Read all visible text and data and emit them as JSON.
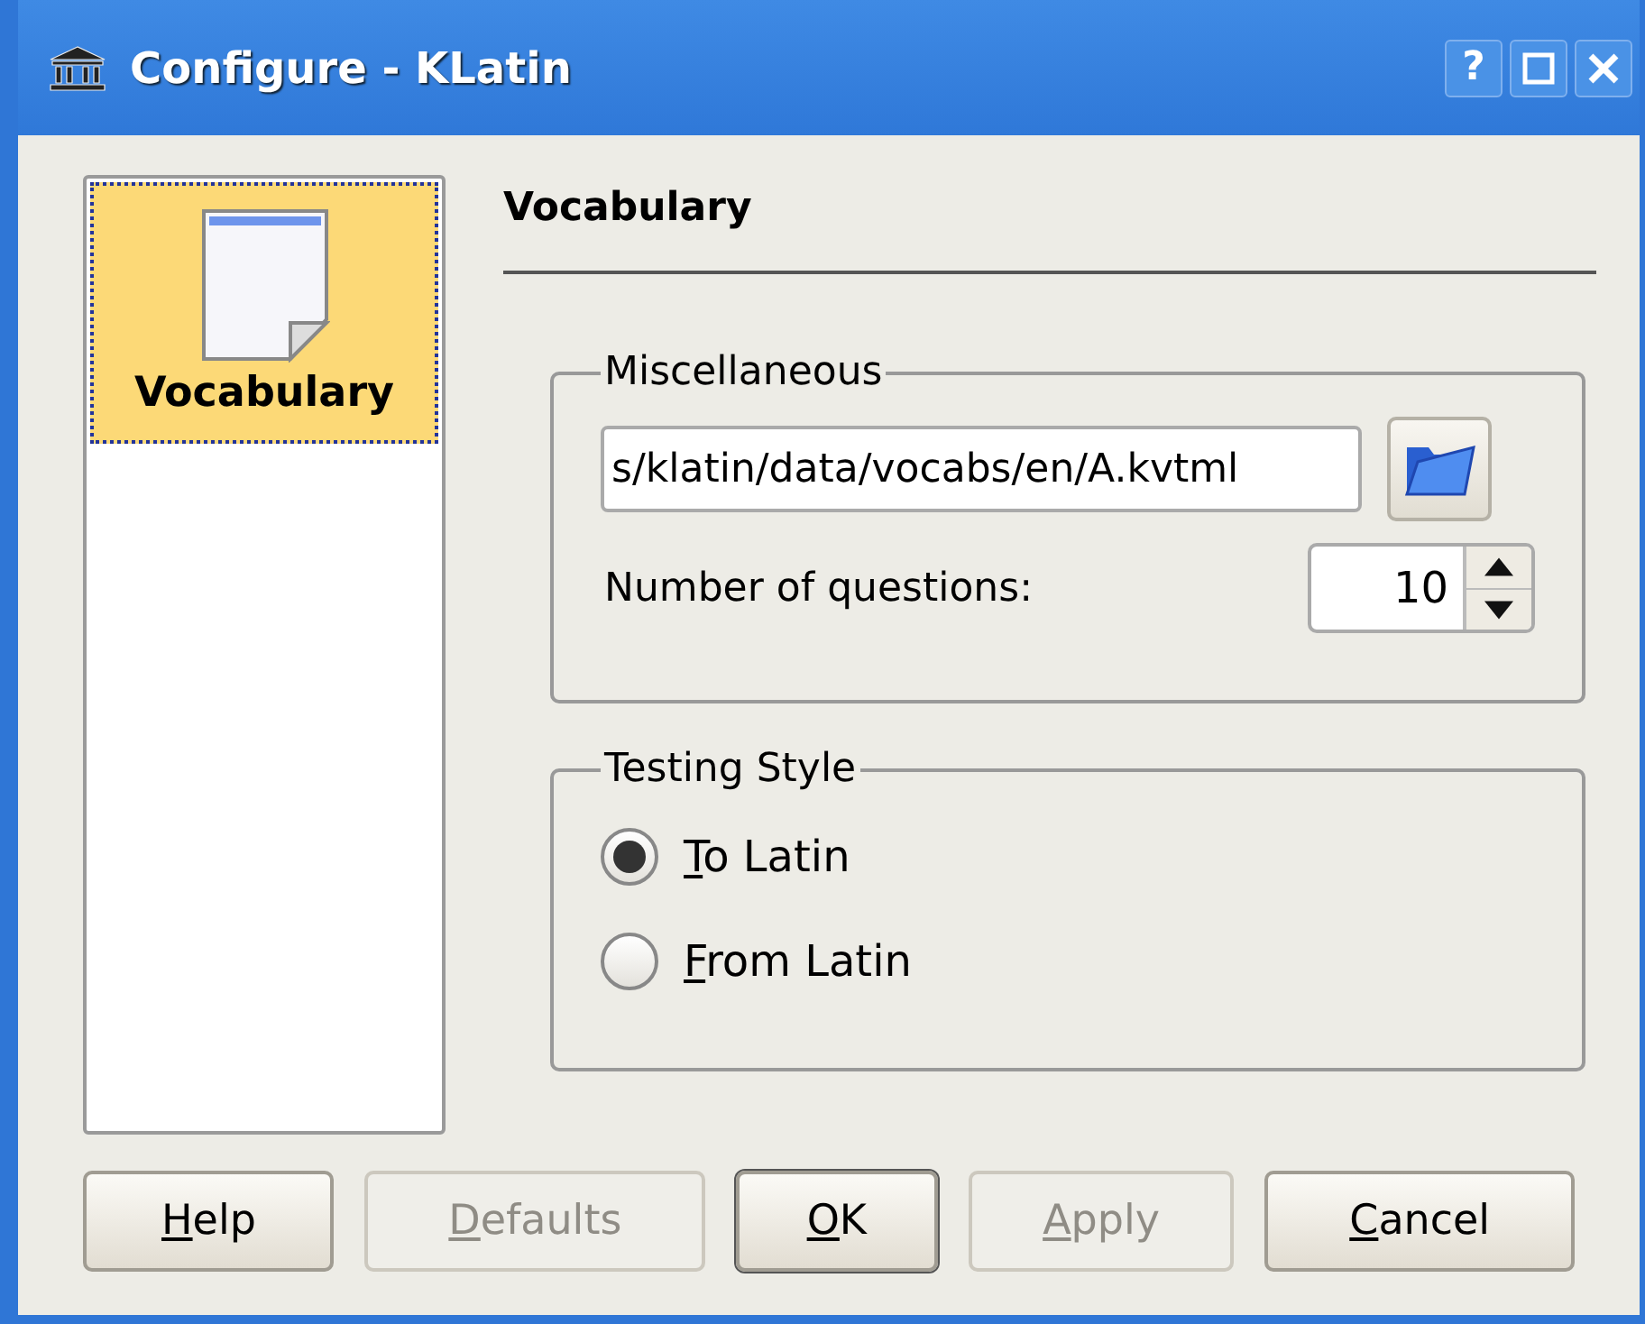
{
  "window": {
    "title": "Configure - KLatin",
    "controls": [
      {
        "kind": "help",
        "label": "?"
      },
      {
        "kind": "maximize"
      },
      {
        "kind": "close"
      }
    ]
  },
  "sidebar": {
    "items": [
      {
        "label": "Vocabulary",
        "selected": true
      }
    ]
  },
  "page": {
    "title": "Vocabulary"
  },
  "groups": [
    {
      "title": "Miscellaneous",
      "file_path": "s/klatin/data/vocabs/en/A.kvtml",
      "questions_label": "Number of questions:",
      "questions_value": "10"
    },
    {
      "title": "Testing Style",
      "options": [
        {
          "label": "To Latin",
          "selected": true
        },
        {
          "label": "From Latin",
          "selected": false
        }
      ]
    }
  ],
  "buttons": [
    {
      "label": "Help",
      "disabled": false,
      "default": false
    },
    {
      "label": "Defaults",
      "disabled": true,
      "default": false
    },
    {
      "label": "OK",
      "disabled": false,
      "default": true
    },
    {
      "label": "Apply",
      "disabled": true,
      "default": false
    },
    {
      "label": "Cancel",
      "disabled": false,
      "default": false
    }
  ]
}
